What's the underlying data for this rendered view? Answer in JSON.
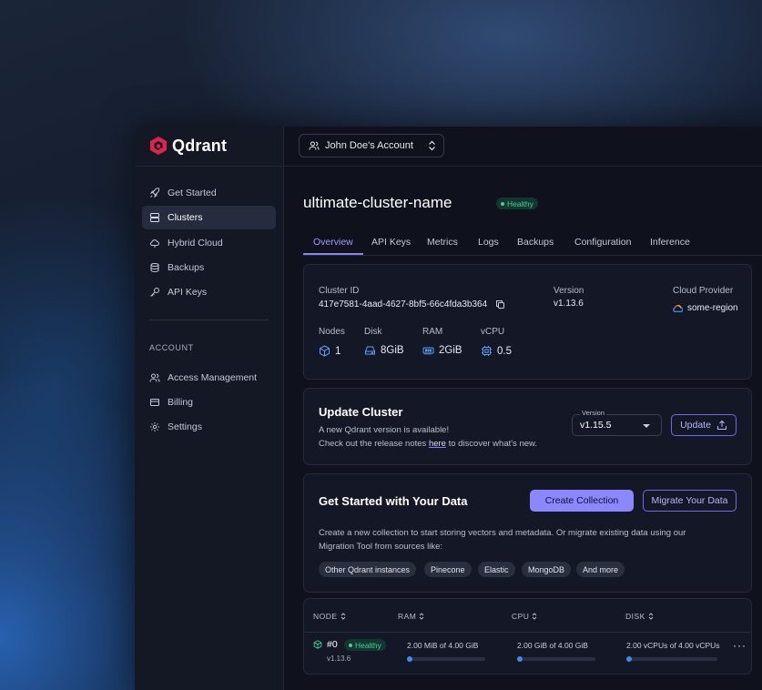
{
  "brand": {
    "name": "Qdrant",
    "accent": "#dc244c"
  },
  "account": {
    "label": "John Doe's Account"
  },
  "sidebar": {
    "items": [
      {
        "label": "Get Started",
        "icon": "rocket-icon"
      },
      {
        "label": "Clusters",
        "icon": "server-icon"
      },
      {
        "label": "Hybrid Cloud",
        "icon": "cloud-icon"
      },
      {
        "label": "Backups",
        "icon": "database-icon"
      },
      {
        "label": "API Keys",
        "icon": "key-icon"
      }
    ],
    "account_heading": "ACCOUNT",
    "account_items": [
      {
        "label": "Access Management",
        "icon": "users-icon"
      },
      {
        "label": "Billing",
        "icon": "credit-card-icon"
      },
      {
        "label": "Settings",
        "icon": "gear-icon"
      }
    ]
  },
  "cluster": {
    "name": "ultimate-cluster-name",
    "status": "Healthy",
    "tabs": [
      "Overview",
      "API Keys",
      "Metrics",
      "Logs",
      "Backups",
      "Configuration",
      "Inference"
    ],
    "active_tab": "Overview",
    "overview": {
      "cluster_id_label": "Cluster ID",
      "cluster_id": "417e7581-4aad-4627-8bf5-66c4fda3b364",
      "version_label": "Version",
      "version": "v1.13.6",
      "provider_label": "Cloud Provider",
      "provider_region": "some-region",
      "nodes_label": "Nodes",
      "nodes": "1",
      "disk_label": "Disk",
      "disk": "8GiB",
      "ram_label": "RAM",
      "ram": "2GiB",
      "vcpu_label": "vCPU",
      "vcpu": "0.5"
    }
  },
  "update": {
    "title": "Update Cluster",
    "line1": "A new Qdrant version is available!",
    "line2_pre": "Check out the release notes ",
    "line2_link": "here",
    "line2_post": " to discover what's new.",
    "version_legend": "Version",
    "version_selected": "v1.15.5",
    "button": "Update"
  },
  "get_started": {
    "title": "Get Started with Your Data",
    "create_button": "Create Collection",
    "migrate_button": "Migrate Your Data",
    "description_line1": "Create a new collection to start storing vectors and metadata. Or migrate existing data using our",
    "description_line2": "Migration Tool from sources like:",
    "chips": [
      "Other Qdrant instances",
      "Pinecone",
      "Elastic",
      "MongoDB",
      "And more"
    ]
  },
  "nodes_table": {
    "headers": [
      "NODE",
      "RAM",
      "CPU",
      "DISK"
    ],
    "rows": [
      {
        "node": "#0",
        "status": "Healthy",
        "version": "v1.13.6",
        "ram": "2.00 MiB of 4.00 GiB",
        "cpu": "2.00 GiB of 4.00 GiB",
        "disk": "2.00 vCPUs of 4.00 vCPUs"
      }
    ]
  },
  "colors": {
    "primary": "#8b87ff",
    "healthy": "#3ed49a",
    "background": "#0f121c"
  }
}
